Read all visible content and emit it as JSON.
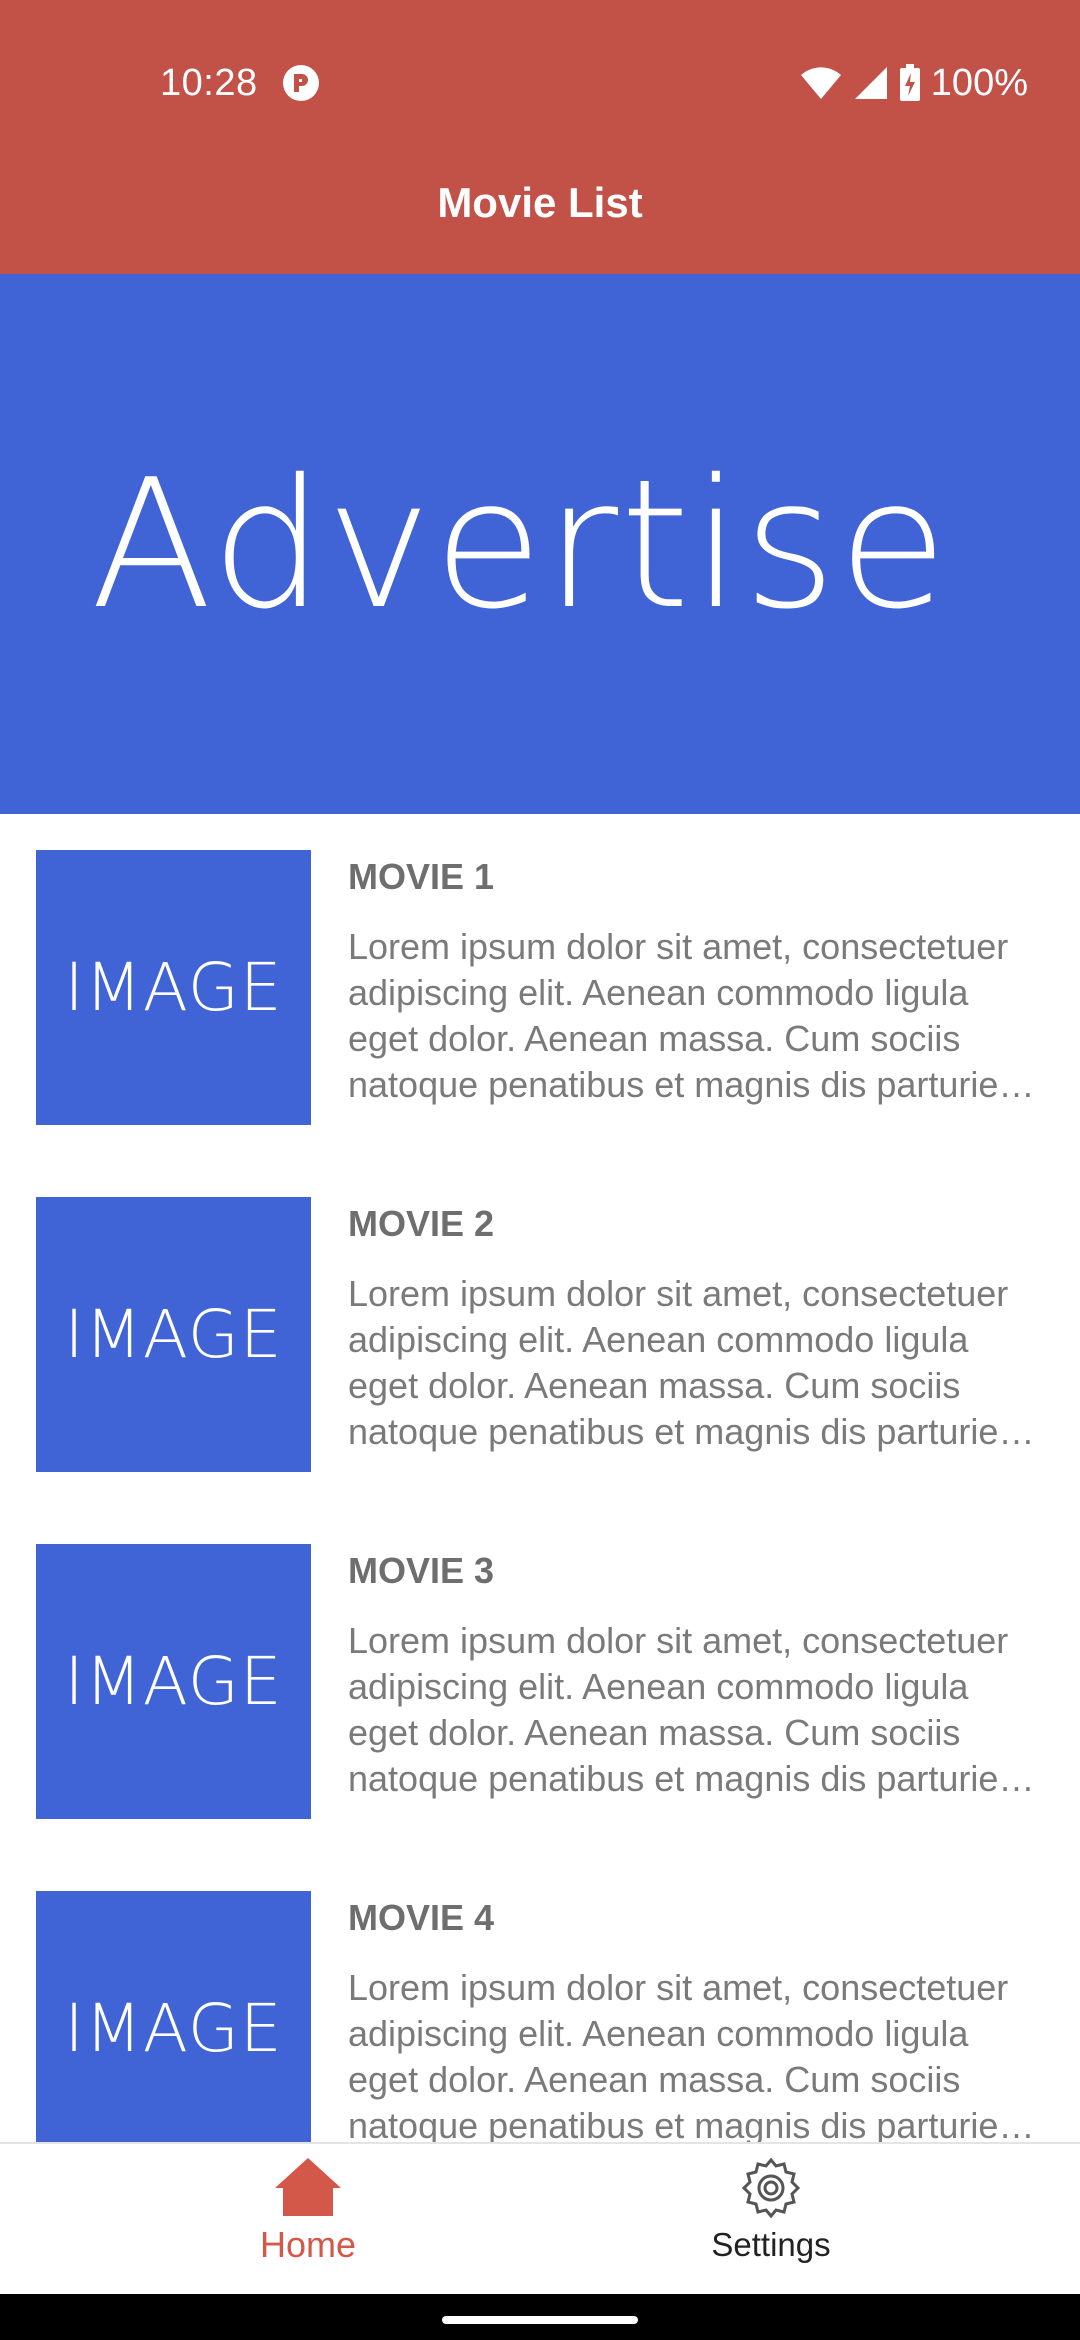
{
  "status_bar": {
    "time": "10:28",
    "battery_text": "100%",
    "icons": [
      "app-notification-icon",
      "wifi-icon",
      "cell-signal-icon",
      "battery-charging-icon"
    ]
  },
  "app_bar": {
    "title": "Movie List"
  },
  "ad_banner": {
    "text": "Advertise"
  },
  "movies": [
    {
      "image_text": "IMAGE",
      "title": "MOVIE 1",
      "description": "Lorem ipsum dolor sit amet, consectetuer adipiscing elit. Aenean commodo ligula eget dolor. Aenean massa. Cum sociis natoque penatibus et magnis dis parturient montes"
    },
    {
      "image_text": "IMAGE",
      "title": "MOVIE 2",
      "description": "Lorem ipsum dolor sit amet, consectetuer adipiscing elit. Aenean commodo ligula eget dolor. Aenean massa. Cum sociis natoque penatibus et magnis dis parturient montes"
    },
    {
      "image_text": "IMAGE",
      "title": "MOVIE 3",
      "description": "Lorem ipsum dolor sit amet, consectetuer adipiscing elit. Aenean commodo ligula eget dolor. Aenean massa. Cum sociis natoque penatibus et magnis dis parturient montes"
    },
    {
      "image_text": "IMAGE",
      "title": "MOVIE 4",
      "description": "Lorem ipsum dolor sit amet, consectetuer adipiscing elit. Aenean commodo ligula eget dolor. Aenean massa. Cum sociis natoque penatibus et magnis dis parturient montes"
    }
  ],
  "bottom_nav": {
    "items": [
      {
        "label": "Home",
        "icon": "home-icon",
        "selected": true
      },
      {
        "label": "Settings",
        "icon": "gear-icon",
        "selected": false
      }
    ]
  },
  "colors": {
    "primary": "#c25248",
    "banner_blue": "#4063d6",
    "nav_active": "#d4584a"
  }
}
